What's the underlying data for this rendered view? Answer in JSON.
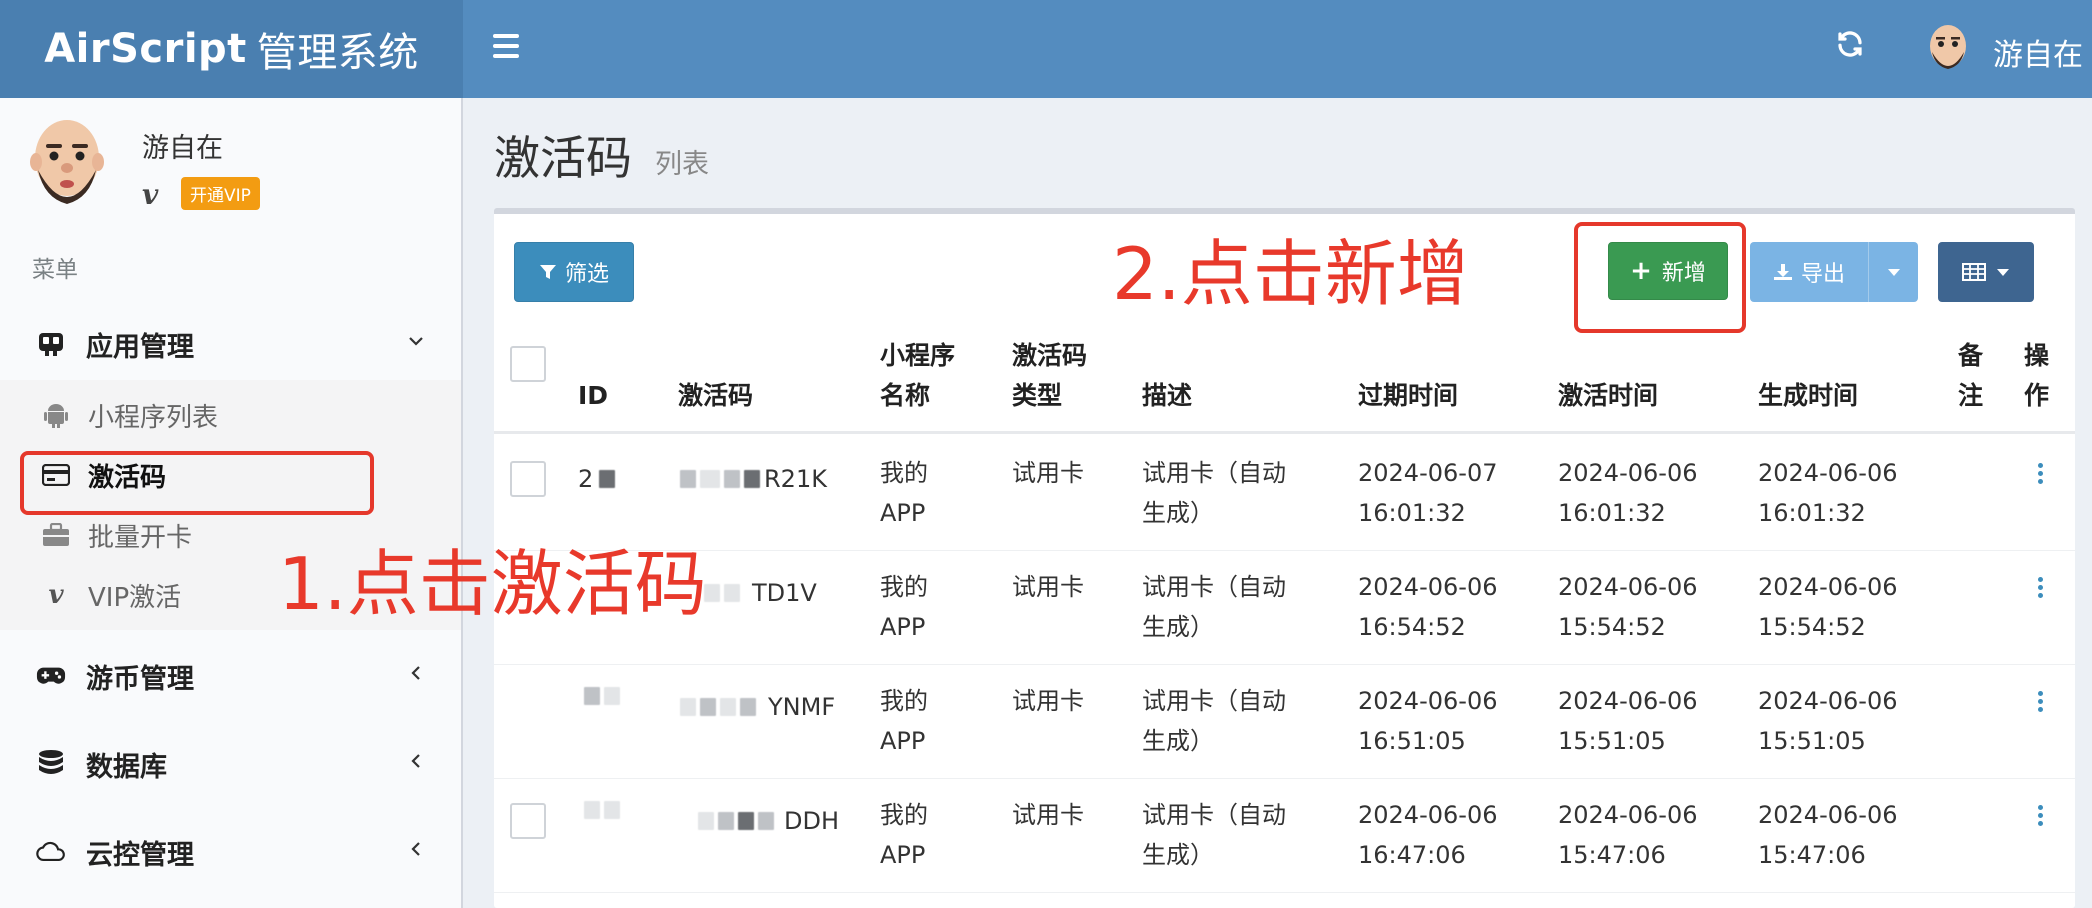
{
  "header": {
    "logo_bold": "AirScript",
    "logo_light": "管理系统",
    "menu_icon": "hamburger-icon",
    "refresh_icon": "refresh-icon",
    "user_name": "游自在"
  },
  "sidebar": {
    "user_name": "游自在",
    "vip_mark": "v",
    "vip_badge": "开通VIP",
    "menu_header": "菜单",
    "groups": [
      {
        "label": "应用管理",
        "icon": "app-icon",
        "chevron": "˅"
      },
      {
        "label": "游币管理",
        "icon": "gamepad-icon",
        "chevron": "‹"
      },
      {
        "label": "数据库",
        "icon": "database-icon",
        "chevron": "‹"
      },
      {
        "label": "云控管理",
        "icon": "cloud-icon",
        "chevron": "‹"
      }
    ],
    "sub_items": [
      {
        "label": "小程序列表",
        "icon": "android-icon"
      },
      {
        "label": "激活码",
        "icon": "credit-card-icon"
      },
      {
        "label": "批量开卡",
        "icon": "briefcase-icon"
      },
      {
        "label": "VIP激活",
        "icon": "vimeo-icon"
      }
    ]
  },
  "annotations": {
    "step1": "1.点击激活码",
    "step2": "2.点击新增",
    "color": "#e8392b"
  },
  "page": {
    "title": "激活码",
    "subtitle": "列表"
  },
  "toolbar": {
    "filter_label": "筛选",
    "add_label": "新增",
    "export_label": "导出"
  },
  "table": {
    "headers": {
      "id": "ID",
      "code": "激活码",
      "app_name_1": "小程序",
      "app_name_2": "名称",
      "type_1": "激活码",
      "type_2": "类型",
      "desc": "描述",
      "expire": "过期时间",
      "activate": "激活时间",
      "created": "生成时间",
      "remark_1": "备",
      "remark_2": "注",
      "ops_1": "操",
      "ops_2": "作"
    },
    "rows": [
      {
        "id_visible": "2",
        "code_suffix": "R21K",
        "app_1": "我的",
        "app_2": "APP",
        "type": "试用卡",
        "desc_1": "试用卡（自动",
        "desc_2": "生成）",
        "expire_1": "2024-06-07",
        "expire_2": "16:01:32",
        "activate_1": "2024-06-06",
        "activate_2": "16:01:32",
        "created_1": "2024-06-06",
        "created_2": "16:01:32"
      },
      {
        "id_visible": "",
        "code_suffix": "TD1V",
        "app_1": "我的",
        "app_2": "APP",
        "type": "试用卡",
        "desc_1": "试用卡（自动",
        "desc_2": "生成）",
        "expire_1": "2024-06-06",
        "expire_2": "16:54:52",
        "activate_1": "2024-06-06",
        "activate_2": "15:54:52",
        "created_1": "2024-06-06",
        "created_2": "15:54:52"
      },
      {
        "id_visible": "",
        "code_suffix": "YNMF",
        "app_1": "我的",
        "app_2": "APP",
        "type": "试用卡",
        "desc_1": "试用卡（自动",
        "desc_2": "生成）",
        "expire_1": "2024-06-06",
        "expire_2": "16:51:05",
        "activate_1": "2024-06-06",
        "activate_2": "15:51:05",
        "created_1": "2024-06-06",
        "created_2": "15:51:05"
      },
      {
        "id_visible": "",
        "code_suffix": "DDH",
        "app_1": "我的",
        "app_2": "APP",
        "type": "试用卡",
        "desc_1": "试用卡（自动",
        "desc_2": "生成）",
        "expire_1": "2024-06-06",
        "expire_2": "16:47:06",
        "activate_1": "2024-06-06",
        "activate_2": "15:47:06",
        "created_1": "2024-06-06",
        "created_2": "15:47:06"
      }
    ]
  },
  "colors": {
    "header_bg": "#548cbf",
    "logo_bg": "#4a7fb0",
    "btn_primary": "#3c8dbc",
    "btn_success": "#3a9a52",
    "btn_export": "#7bb4e4",
    "btn_columns": "#3e6590",
    "vip_badge": "#f39c12"
  }
}
